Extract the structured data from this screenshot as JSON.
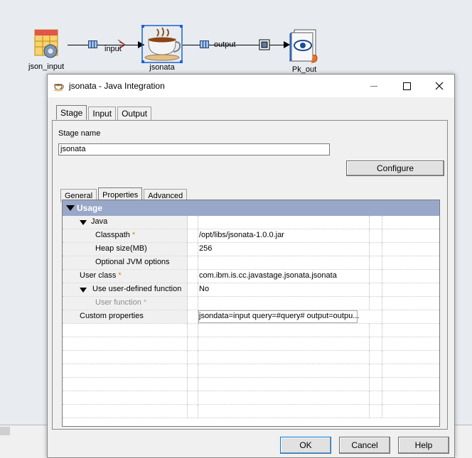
{
  "canvas": {
    "stages": [
      {
        "label": "json_input",
        "icon": "file-table-gear-icon"
      },
      {
        "label": "jsonata",
        "icon": "coffee-cup-icon"
      },
      {
        "label": "Pk_out",
        "icon": "peek-eye-icon"
      }
    ],
    "links": [
      {
        "label": "input"
      },
      {
        "label": "output"
      }
    ]
  },
  "dialog": {
    "title": "jsonata - Java Integration",
    "tabs": [
      "Stage",
      "Input",
      "Output"
    ],
    "active_tab": "Stage",
    "stage_name_label": "Stage name",
    "stage_name_value": "jsonata",
    "configure_label": "Configure",
    "subtabs": [
      "General",
      "Properties",
      "Advanced"
    ],
    "active_subtab": "Properties",
    "grid": {
      "section": "Usage",
      "rows": [
        {
          "name": "Java",
          "value": "",
          "required": false,
          "disabled": false
        },
        {
          "name": "Classpath",
          "value": "/opt/libs/jsonata-1.0.0.jar",
          "required": true,
          "disabled": false
        },
        {
          "name": "Heap size(MB)",
          "value": "256",
          "required": false,
          "disabled": false
        },
        {
          "name": "Optional JVM options",
          "value": "",
          "required": false,
          "disabled": false
        },
        {
          "name": "User class",
          "value": "com.ibm.is.cc.javastage.jsonata.jsonata",
          "required": true,
          "disabled": false
        },
        {
          "name": "Use user-defined function",
          "value": "No",
          "required": false,
          "disabled": false
        },
        {
          "name": "User function",
          "value": "",
          "required": true,
          "disabled": true
        },
        {
          "name": "Custom properties",
          "value": "jsondata=input query=#query# output=outpu...",
          "required": false,
          "disabled": false
        }
      ],
      "required_marker": "*"
    },
    "buttons": {
      "ok": "OK",
      "cancel": "Cancel",
      "help": "Help"
    }
  }
}
